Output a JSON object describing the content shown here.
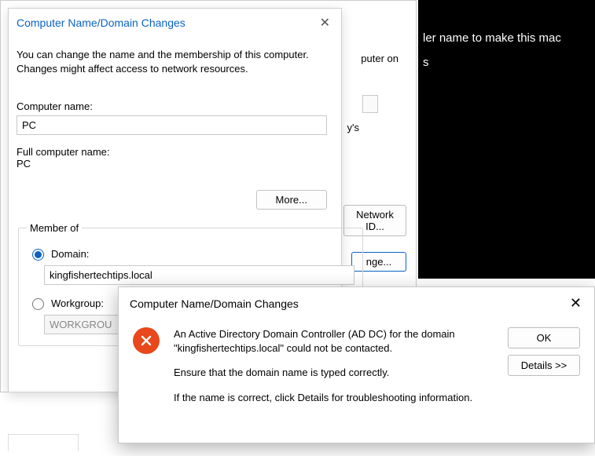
{
  "darkPane": {
    "line1": "ler name to make this mac",
    "line2": "s"
  },
  "sysprop": {
    "descFrag1": "puter on",
    "descFrag2": "y's",
    "networkIdBtn": "Network ID...",
    "changeBtn": "nge..."
  },
  "dlg1": {
    "title": "Computer Name/Domain Changes",
    "desc": "You can change the name and the membership of this computer. Changes might affect access to network resources.",
    "computerNameLabel": "Computer name:",
    "computerNameValue": "PC",
    "fullNameLabel": "Full computer name:",
    "fullNameValue": "PC",
    "moreBtn": "More...",
    "memberOf": "Member of",
    "domainLabel": "Domain:",
    "domainValue": "kingfishertechtips.local",
    "workgroupLabel": "Workgroup:",
    "workgroupValue": "WORKGROU"
  },
  "dlg2": {
    "title": "Computer Name/Domain Changes",
    "msg1": "An Active Directory Domain Controller (AD DC) for the domain \"kingfishertechtips.local\" could not be contacted.",
    "msg2": "Ensure that the domain name is typed correctly.",
    "msg3": "If the name is correct, click Details for troubleshooting information.",
    "okBtn": "OK",
    "detailsBtn": "Details >>"
  }
}
